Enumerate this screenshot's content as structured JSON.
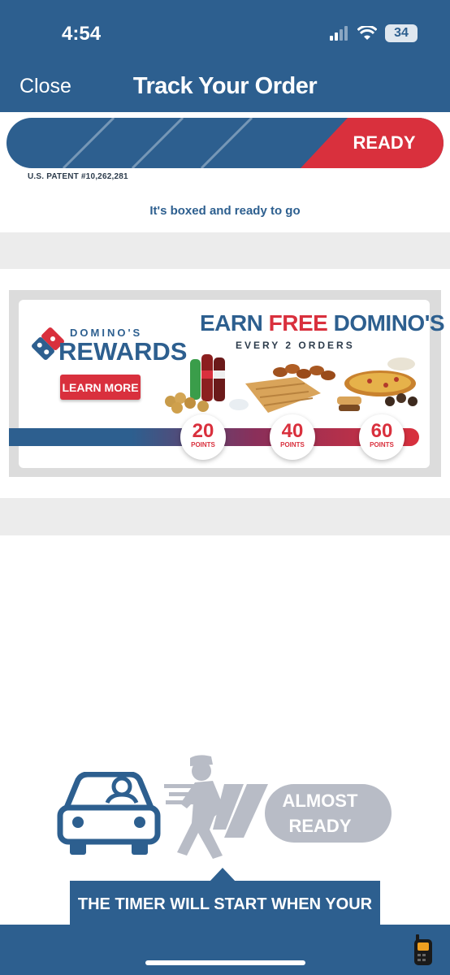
{
  "status_bar": {
    "time": "4:54",
    "battery": "34"
  },
  "header": {
    "close_label": "Close",
    "title": "Track Your Order"
  },
  "tracker": {
    "current_stage": "READY",
    "patent": "U.S. PATENT #10,262,281",
    "status_message": "It's boxed and ready to go"
  },
  "rewards_banner": {
    "brand_top": "DOMINO'S",
    "brand_bottom": "REWARDS",
    "headline_earn": "EARN",
    "headline_free": "FREE",
    "headline_dominos": "DOMINO'S",
    "subline": "EVERY 2 ORDERS",
    "cta_label": "LEARN MORE",
    "milestones": [
      {
        "points": "20",
        "label": "POINTS"
      },
      {
        "points": "40",
        "label": "POINTS"
      },
      {
        "points": "60",
        "label": "POINTS"
      }
    ]
  },
  "stage_info": {
    "stage_label_line1": "ALMOST",
    "stage_label_line2": "READY",
    "timer_text": "THE TIMER WILL START WHEN YOUR"
  },
  "colors": {
    "brand_blue": "#2d5f8f",
    "brand_red": "#d9303d",
    "inactive_gray": "#b8bcc6"
  }
}
